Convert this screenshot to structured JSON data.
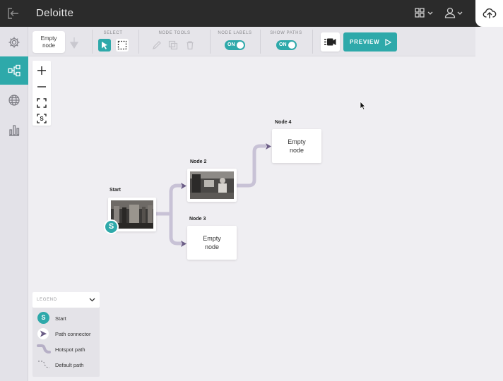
{
  "app": {
    "brand": "Deloitte"
  },
  "toolbar": {
    "empty_node_line1": "Empty",
    "empty_node_line2": "node",
    "select_title": "SELECT",
    "node_tools_title": "NODE TOOLS",
    "node_labels_title": "NODE LABELS",
    "show_paths_title": "SHOW PATHS",
    "node_labels_state": "ON",
    "show_paths_state": "ON",
    "preview_label": "PREVIEW"
  },
  "rail": {
    "items": [
      {
        "icon": "gear-icon"
      },
      {
        "icon": "flow-map-icon",
        "active": true
      },
      {
        "icon": "globe-icon"
      },
      {
        "icon": "analytics-icon"
      }
    ]
  },
  "nodes": {
    "start": {
      "label": "Start",
      "badge": "S"
    },
    "node2": {
      "label": "Node 2"
    },
    "node3": {
      "label": "Node 3",
      "line1": "Empty",
      "line2": "node"
    },
    "node4": {
      "label": "Node 4",
      "line1": "Empty",
      "line2": "node"
    }
  },
  "legend": {
    "title": "LEGEND",
    "items": [
      {
        "label": "Start",
        "symbol": "S"
      },
      {
        "label": "Path connector"
      },
      {
        "label": "Hotspot path"
      },
      {
        "label": "Default path"
      }
    ]
  },
  "colors": {
    "accent": "#2ea9aa",
    "path": "#c8c2d6",
    "connector": "#6b5d86",
    "topbar": "#2b2b2b"
  }
}
